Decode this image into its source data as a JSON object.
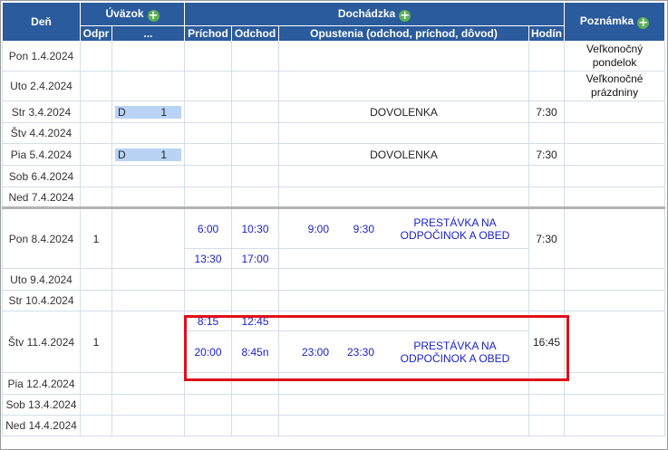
{
  "headers": {
    "den": "Deň",
    "uvazok": "Úväzok",
    "dochadzka": "Dochádzka",
    "poznamka": "Poznámka",
    "odpr": "Odpr",
    "dots": "...",
    "prichod": "Príchod",
    "odchod": "Odchod",
    "opustenia": "Opustenia (odchod, príchod, dôvod)",
    "hodin": "Hodín"
  },
  "icons": {
    "add": "+"
  },
  "rows": {
    "r1": {
      "day": "Pon 1.4.2024",
      "note_line1": "Veľkonočný",
      "note_line2": "pondelok"
    },
    "r2": {
      "day": "Uto 2.4.2024",
      "note_line1": "Veľkonočné",
      "note_line2": "prázdniny"
    },
    "r3": {
      "day": "Str 3.4.2024",
      "code": "D",
      "count": "1",
      "absence": "DOVOLENKA",
      "hours": "7:30"
    },
    "r4": {
      "day": "Štv 4.4.2024"
    },
    "r5": {
      "day": "Pia 5.4.2024",
      "code": "D",
      "count": "1",
      "absence": "DOVOLENKA",
      "hours": "7:30"
    },
    "r6": {
      "day": "Sob 6.4.2024"
    },
    "r7": {
      "day": "Ned 7.4.2024"
    },
    "r8": {
      "day": "Pon 8.4.2024",
      "odpr": "1",
      "in1": "6:00",
      "out1": "10:30",
      "leave_out": "9:00",
      "leave_in": "9:30",
      "reason": "PRESTÁVKA NA ODPOČINOK A OBED",
      "in2": "13:30",
      "out2": "17:00",
      "hours": "7:30"
    },
    "r9": {
      "day": "Uto 9.4.2024"
    },
    "r10": {
      "day": "Str 10.4.2024"
    },
    "r11": {
      "day": "Štv 11.4.2024",
      "odpr": "1",
      "in1": "8:15",
      "out1": "12:45",
      "in2": "20:00",
      "out2": "8:45n",
      "leave_out": "23:00",
      "leave_in": "23:30",
      "reason": "PRESTÁVKA NA ODPOČINOK A OBED",
      "hours": "16:45"
    },
    "r12": {
      "day": "Pia 12.4.2024"
    },
    "r13": {
      "day": "Sob 13.4.2024"
    },
    "r14": {
      "day": "Ned 14.4.2024"
    }
  },
  "colors": {
    "header_bg": "#2a5b9c",
    "add_icon": "#5cae57",
    "time_text": "#1a22c8",
    "highlight": "#e0101a",
    "absence_bar": "#b9d3f5"
  }
}
